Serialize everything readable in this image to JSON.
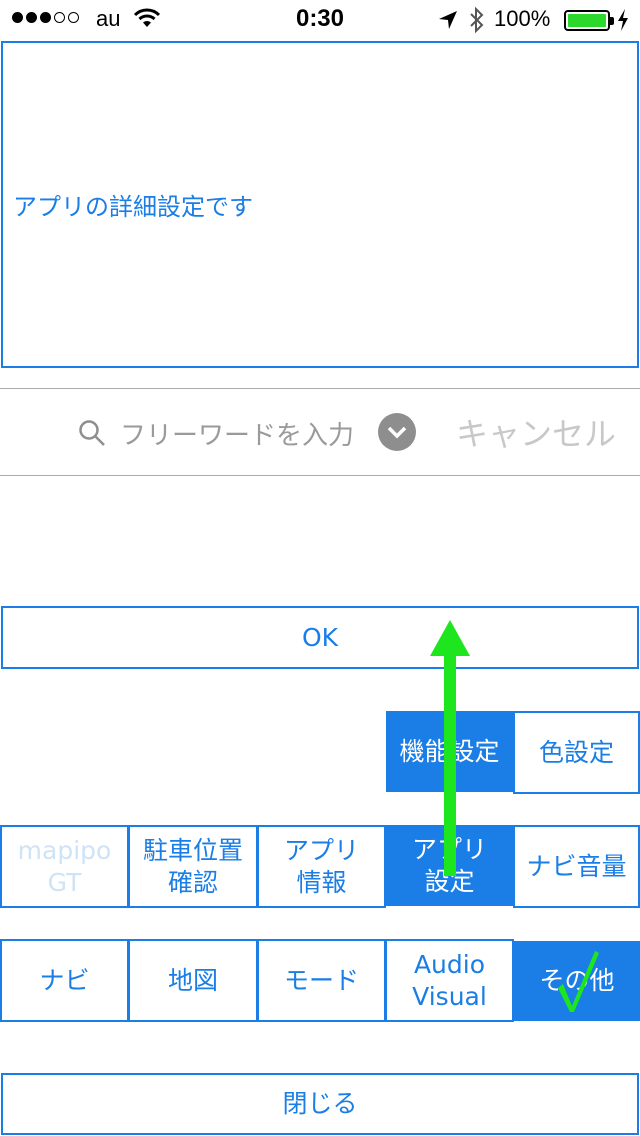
{
  "status_bar": {
    "carrier": "au",
    "time": "0:30",
    "battery_percent": "100%",
    "battery_color": "#2bd82b"
  },
  "description": {
    "text": "アプリの詳細設定です"
  },
  "search": {
    "placeholder": "フリーワードを入力",
    "cancel_label": "キャンセル"
  },
  "ok_label": "OK",
  "menu_row1": {
    "function_settings": "機能設定",
    "color_settings": "色設定"
  },
  "menu_row2": {
    "mapipo_line1": "mapipo",
    "mapipo_line2": "GT",
    "parking_line1": "駐車位置",
    "parking_line2": "確認",
    "appinfo_line1": "アプリ",
    "appinfo_line2": "情報",
    "appsettings_line1": "アプリ",
    "appsettings_line2": "設定",
    "navi_volume": "ナビ音量"
  },
  "menu_row3": {
    "navi": "ナビ",
    "map": "地図",
    "mode": "モード",
    "av_line1": "Audio",
    "av_line2": "Visual",
    "other": "その他"
  },
  "close_label": "閉じる",
  "colors": {
    "accent": "#1a7ee6",
    "annotation": "#1ee61e"
  }
}
